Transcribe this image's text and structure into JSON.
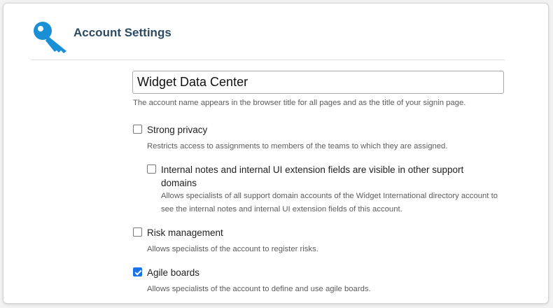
{
  "header": {
    "title": "Account Settings",
    "icon": "key-icon",
    "accent_color": "#1a8fd6"
  },
  "account_name": {
    "value": "Widget Data Center",
    "help": "The account name appears in the browser title for all pages and as the title of your signin page."
  },
  "options": [
    {
      "label": "Strong privacy",
      "checked": false,
      "help": "Restricts access to assignments to members of the teams to which they are assigned."
    },
    {
      "label_line1": "Internal notes and internal UI extension fields are visible in other support",
      "label_line2": "domains",
      "checked": false,
      "help_line1": "Allows specialists of all support domain accounts of the Widget International directory account to",
      "help_line2": "see the internal notes and internal UI extension fields of this account."
    },
    {
      "label": "Risk management",
      "checked": false,
      "help": "Allows specialists of the account to register risks."
    },
    {
      "label": "Agile boards",
      "checked": true,
      "help": "Allows specialists of the account to define and use agile boards."
    }
  ]
}
